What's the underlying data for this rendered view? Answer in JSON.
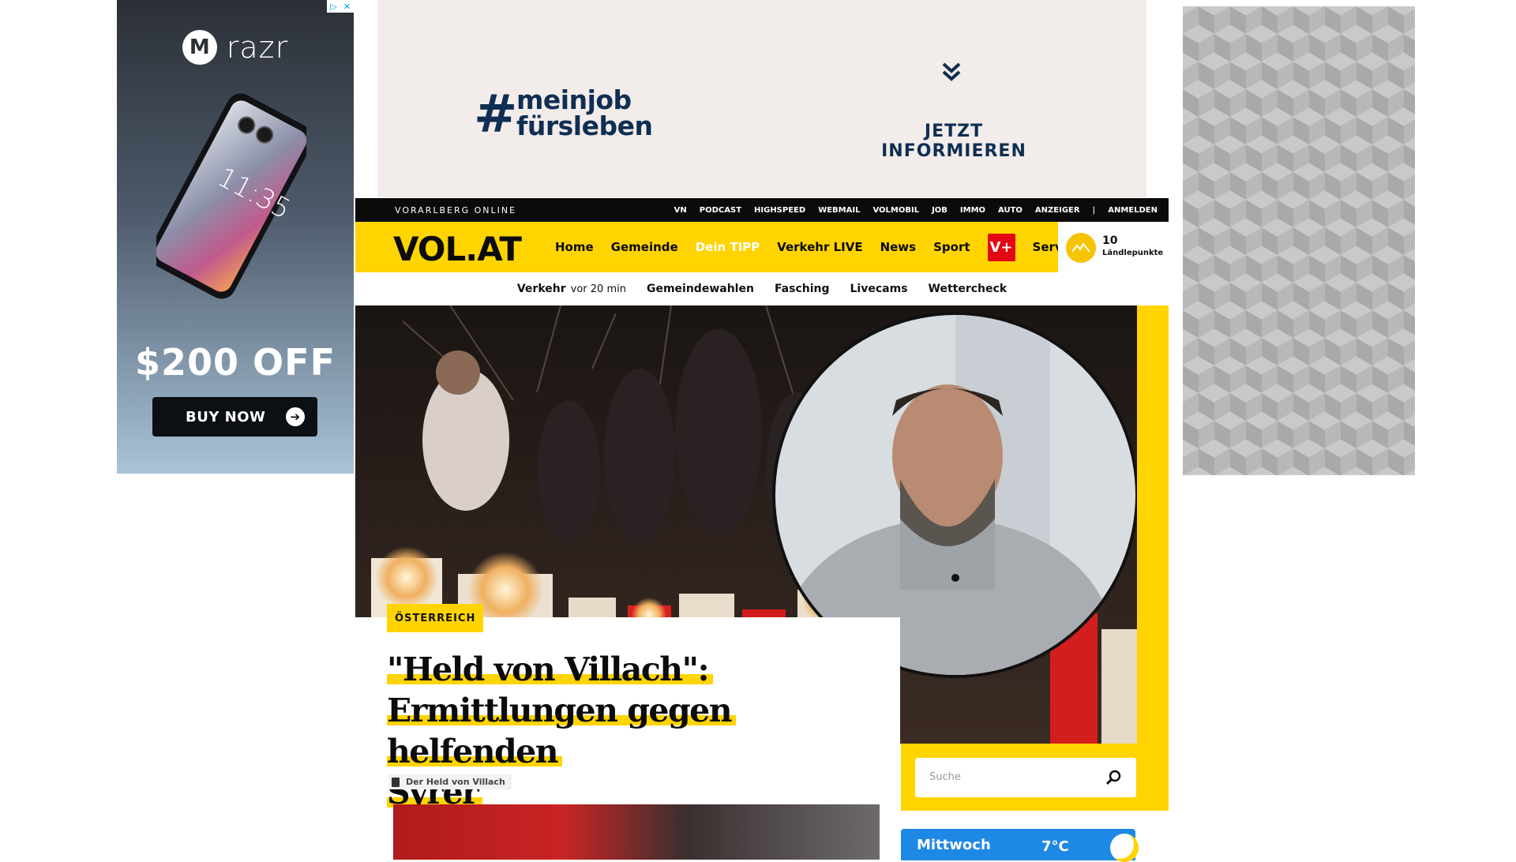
{
  "ad_left": {
    "adchoices": [
      "▷",
      "✕"
    ],
    "brand": "razr",
    "logo_icon": "motorola-logo-icon",
    "phone_time": "11:35",
    "offer": "$200 OFF",
    "button_label": "BUY NOW"
  },
  "ad_top": {
    "hashtag_symbol": "#",
    "hashtag_line1": "meinjob",
    "hashtag_line2": "fürsleben",
    "cta": "JETZT INFORMIEREN",
    "chevron_icon": "double-chevron-down-icon"
  },
  "topbar": {
    "site_name": "VORARLBERG ONLINE",
    "links": [
      "VN",
      "PODCAST",
      "HIGHSPEED",
      "WEBMAIL",
      "VOLMOBIL",
      "JOB",
      "IMMO",
      "AUTO",
      "ANZEIGER"
    ],
    "separator": "|",
    "login": "ANMELDEN"
  },
  "navbar": {
    "logo": "VOL.AT",
    "items": [
      "Home",
      "Gemeinde",
      "Dein TIPP",
      "Verkehr LIVE",
      "News",
      "Sport"
    ],
    "vplus": "V+",
    "service": "Service",
    "points_value": "10",
    "points_label": "Ländlepunkte",
    "colors": {
      "brand_yellow": "#ffd400",
      "vplus_red": "#e30613",
      "active_item": "#ffffff"
    }
  },
  "subnav": {
    "traffic_label": "Verkehr",
    "traffic_time": "vor 20 min",
    "items": [
      "Gemeindewahlen",
      "Fasching",
      "Livecams",
      "Wettercheck"
    ]
  },
  "article": {
    "kicker": "ÖSTERREICH",
    "headline_line1": "\"Held von Villach\":",
    "headline_line2": "Ermittlungen gegen helfenden",
    "headline_line3": "Syrer",
    "tag": "Der Held von Villach"
  },
  "search": {
    "placeholder": "Suche",
    "icon": "search-icon"
  },
  "weather": {
    "day": "Mittwoch",
    "temp": "7°C",
    "icon": "sun-cloud-icon"
  }
}
